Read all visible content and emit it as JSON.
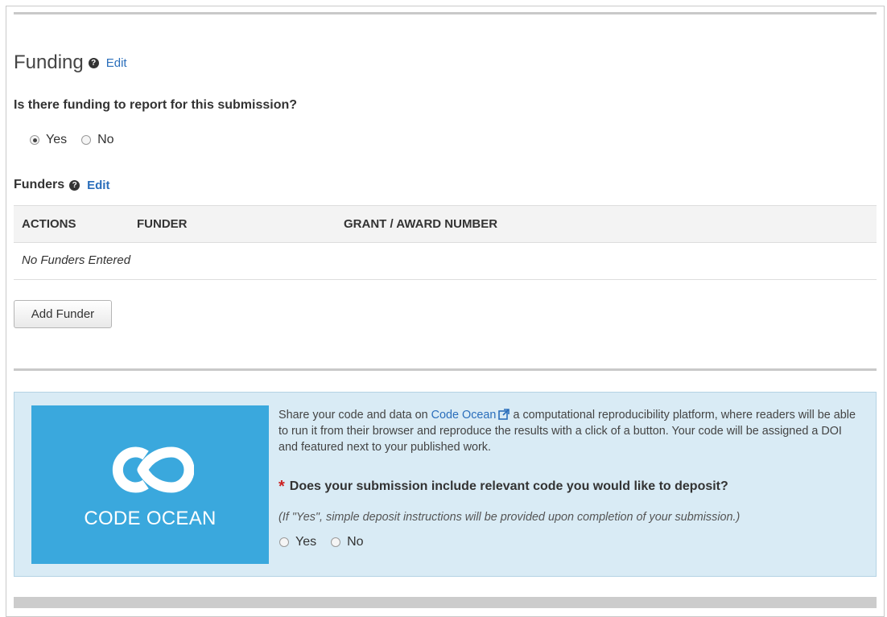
{
  "funding": {
    "title": "Funding",
    "edit_label": "Edit",
    "question": "Is there funding to report for this submission?",
    "options": [
      {
        "label": "Yes",
        "selected": true
      },
      {
        "label": "No",
        "selected": false
      }
    ]
  },
  "funders": {
    "title": "Funders",
    "edit_label": "Edit",
    "columns": [
      "ACTIONS",
      "FUNDER",
      "GRANT / AWARD NUMBER"
    ],
    "empty_text": "No Funders Entered",
    "add_button_label": "Add Funder"
  },
  "code_ocean": {
    "logo_text": "CODE OCEAN",
    "desc_prefix": "Share your code and data on",
    "link_text": "Code Ocean",
    "desc_suffix": "a computational reproducibility platform, where readers will be able to run it from their browser and reproduce the results with a click of a button. Your code will be assigned a DOI and featured next to your published work.",
    "required_marker": "*",
    "question": "Does your submission include relevant code you would like to deposit?",
    "note": "(If \"Yes\", simple deposit instructions will be provided upon completion of your submission.)",
    "options": [
      {
        "label": "Yes",
        "selected": false
      },
      {
        "label": "No",
        "selected": false
      }
    ]
  },
  "colors": {
    "link": "#2a6ebb",
    "panel_bg": "#d9ebf5",
    "logo_bg": "#3aa8dd",
    "required": "#cc2222"
  },
  "icons": {
    "help": "question-circle-icon",
    "external": "external-link-icon",
    "logo": "code-ocean-logo-icon"
  }
}
